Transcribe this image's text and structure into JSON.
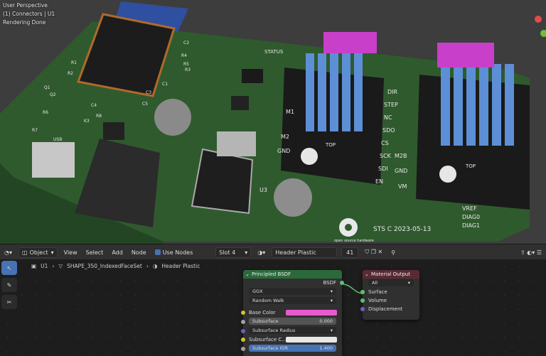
{
  "viewport": {
    "overlay": [
      "User Perspective",
      "(1) Connectors | U1",
      "Rendering Done"
    ],
    "board_silkscreen": [
      "STATUS",
      "TOP",
      "TOP",
      "STS C 2023-05-13",
      "open source hardware",
      "USB",
      "DIR",
      "STEP",
      "NC",
      "SDO",
      "CS",
      "SCK",
      "SDI",
      "EN",
      "M2B",
      "GND",
      "VM",
      "VREF",
      "DIAG0",
      "DIAG1",
      "M1",
      "M2",
      "GND",
      "U3",
      "C2",
      "R4",
      "R5",
      "R3",
      "R1",
      "R2",
      "R6",
      "R7",
      "R8",
      "K3",
      "C4",
      "C5",
      "C1",
      "C3",
      "Q1",
      "Q2"
    ],
    "colors": {
      "board": "#2f5a2e",
      "heatsink": "#5d8fd6",
      "connector": "#c83fc9",
      "chip": "#1c1c1c"
    }
  },
  "header": {
    "editor_icon": "node-editor-icon",
    "mode": "Object",
    "menus": [
      "View",
      "Select",
      "Add",
      "Node"
    ],
    "use_nodes_label": "Use Nodes",
    "slot": "Slot 4",
    "material_name": "Header Plastic",
    "user_count": "41"
  },
  "breadcrumb": {
    "object": "U1",
    "mesh": "SHAPE_350_IndexedFaceSet",
    "material": "Header Plastic"
  },
  "principled": {
    "title": "Principled BSDF",
    "output": "BSDF",
    "distribution": "GGX",
    "subsurface_method": "Random Walk",
    "base_color_label": "Base Color",
    "base_color": "#e85ad0",
    "subsurface_label": "Subsurface",
    "subsurface_value": "0.000",
    "subsurface_radius_label": "Subsurface Radius",
    "subsurface_color_label": "Subsurface C...",
    "subsurface_ior_label": "Subsurface IOR",
    "subsurface_ior_value": "1.400"
  },
  "material_output": {
    "title": "Material Output",
    "target": "All",
    "inputs": [
      "Surface",
      "Volume",
      "Displacement"
    ]
  }
}
